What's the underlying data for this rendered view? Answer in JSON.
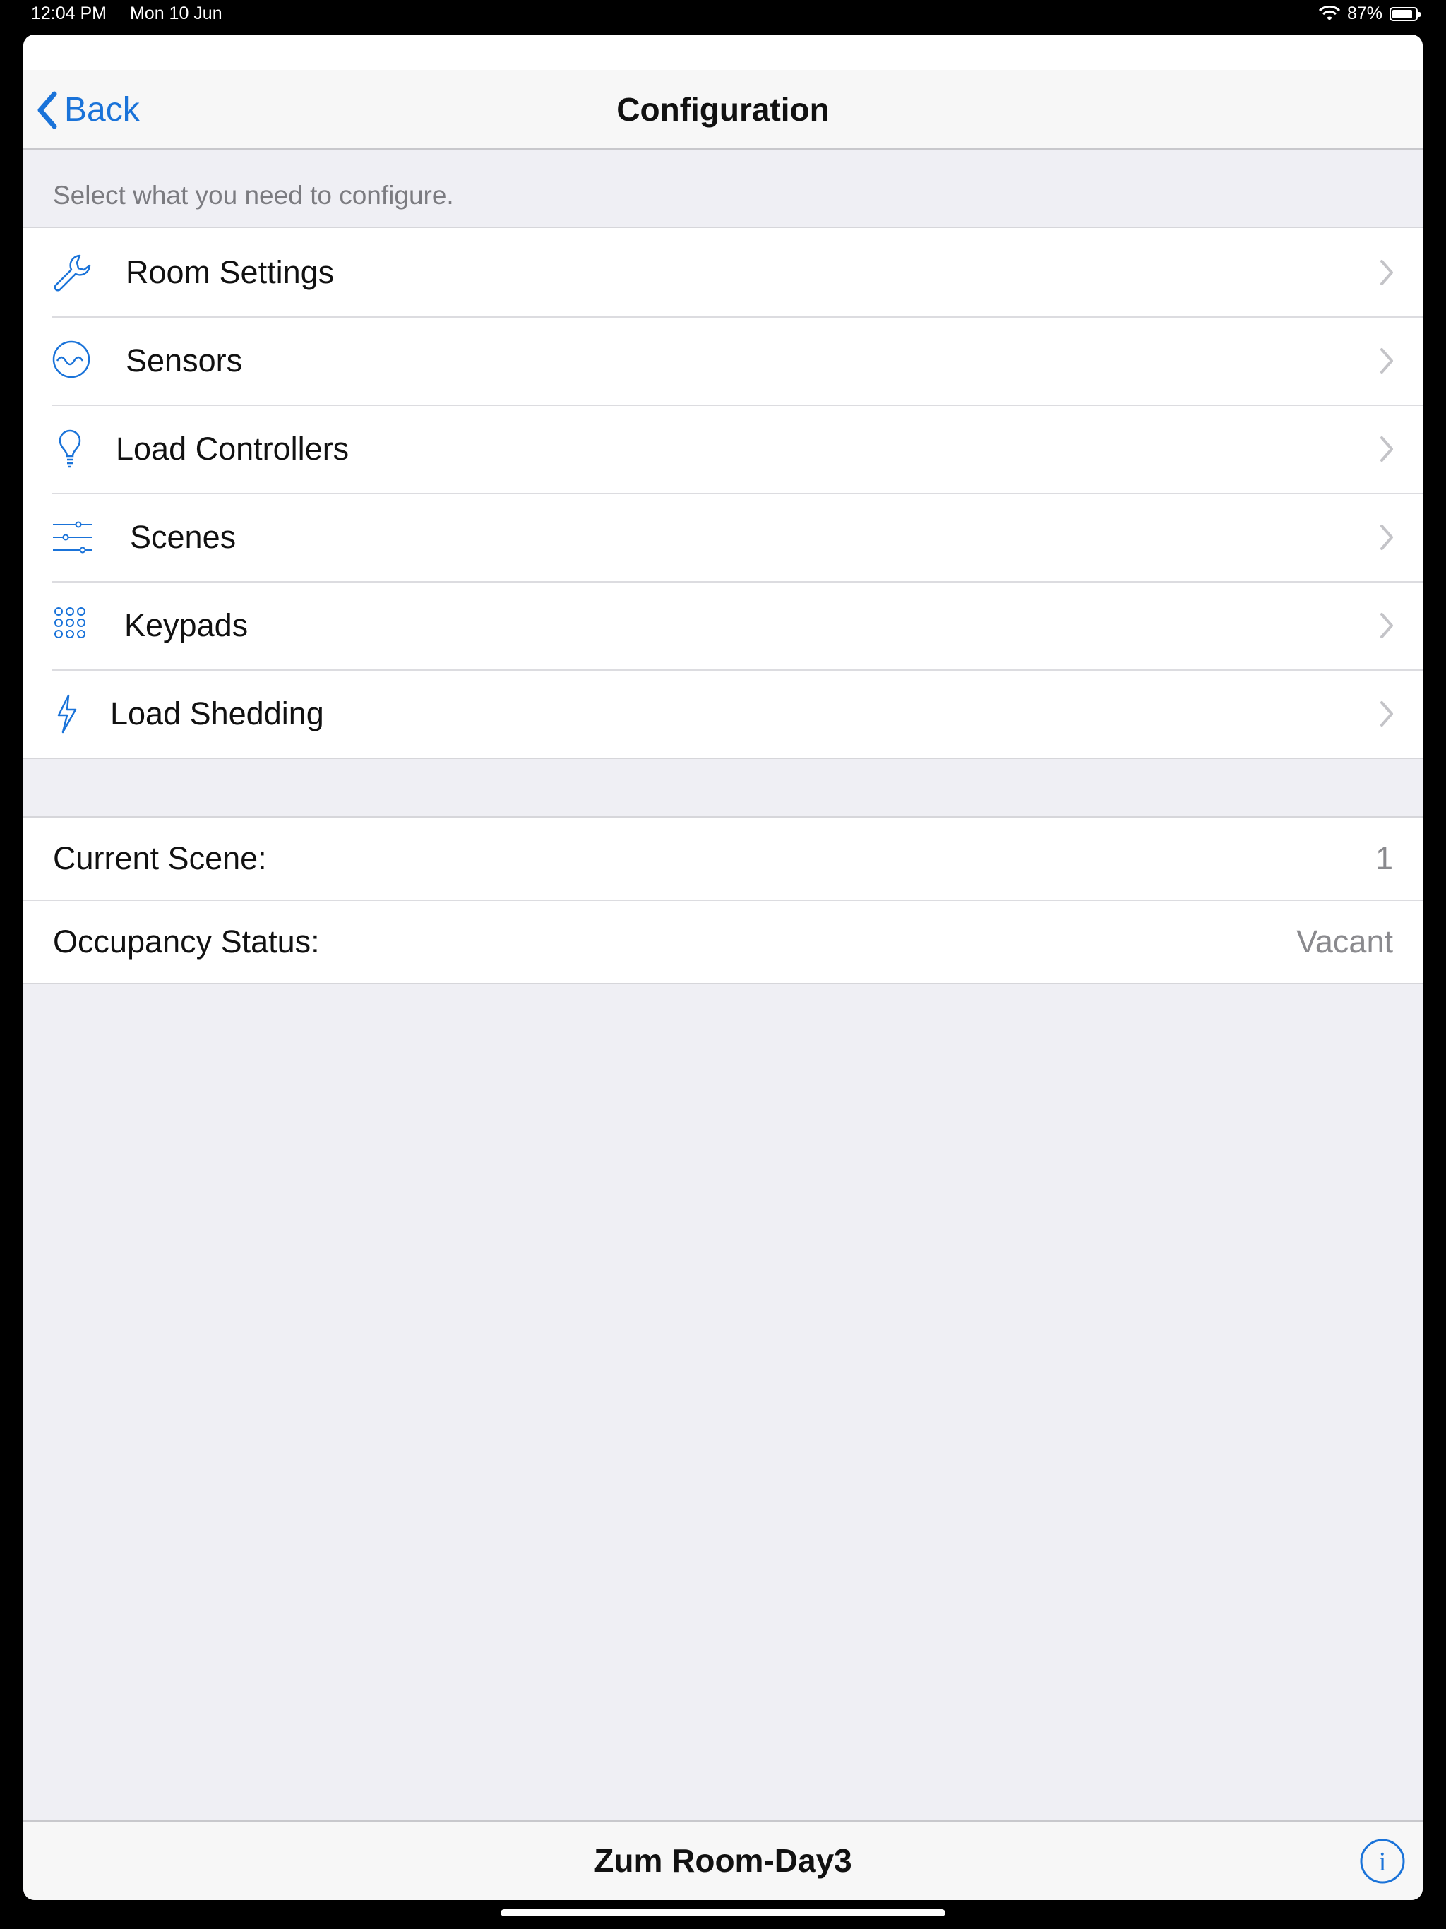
{
  "status_bar": {
    "time": "12:04 PM",
    "date": "Mon 10 Jun",
    "battery_percent": "87%",
    "battery_level": 0.87
  },
  "navbar": {
    "back_label": "Back",
    "title": "Configuration"
  },
  "section_header": "Select what you need to configure.",
  "menu": {
    "items": [
      {
        "label": "Room Settings",
        "icon": "wrench-icon"
      },
      {
        "label": "Sensors",
        "icon": "sensor-wave-icon"
      },
      {
        "label": "Load Controllers",
        "icon": "lightbulb-icon"
      },
      {
        "label": "Scenes",
        "icon": "sliders-icon"
      },
      {
        "label": "Keypads",
        "icon": "keypad-grid-icon"
      },
      {
        "label": "Load Shedding",
        "icon": "lightning-icon"
      }
    ]
  },
  "info": {
    "current_scene_label": "Current Scene:",
    "current_scene_value": "1",
    "occupancy_label": "Occupancy Status:",
    "occupancy_value": "Vacant"
  },
  "bottom_bar": {
    "title": "Zum Room-Day3"
  },
  "colors": {
    "accent": "#1a73d9",
    "background": "#efeff4",
    "bar": "#f7f7f7"
  }
}
